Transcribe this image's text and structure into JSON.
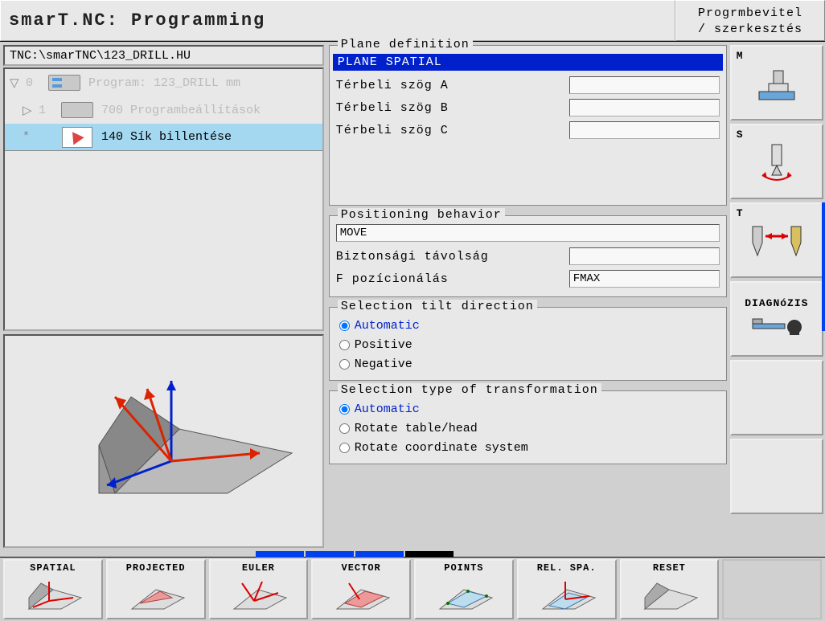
{
  "header": {
    "title": "smarT.NC: Programming",
    "mode_line1": "Progrmbevitel",
    "mode_line2": "/ szerkesztés"
  },
  "filepath": "TNC:\\smarTNC\\123_DRILL.HU",
  "tree": {
    "items": [
      {
        "expand": "▽",
        "num": "0",
        "label": "Program: 123_DRILL mm",
        "icon": "program-icon"
      },
      {
        "expand": "▷",
        "num": "1",
        "label": "700 Programbeállítások",
        "icon": "settings-icon"
      },
      {
        "expand": "*",
        "num": "",
        "label": "140 Sík billentése",
        "icon": "tilt-icon",
        "selected": true
      }
    ]
  },
  "plane": {
    "legend": "Plane definition",
    "highlight": "PLANE SPATIAL",
    "rows": [
      {
        "label": "Térbeli szög A",
        "value": ""
      },
      {
        "label": "Térbeli szög B",
        "value": ""
      },
      {
        "label": "Térbeli szög C",
        "value": ""
      }
    ]
  },
  "positioning": {
    "legend": "Positioning behavior",
    "mode_value": "MOVE",
    "rows": [
      {
        "label": "Biztonsági távolság",
        "value": ""
      },
      {
        "label": "F pozícionálás",
        "value": "FMAX"
      }
    ]
  },
  "tilt": {
    "legend": "Selection tilt direction",
    "options": [
      {
        "label": "Automatic",
        "checked": true,
        "auto": true
      },
      {
        "label": "Positive",
        "checked": false
      },
      {
        "label": "Negative",
        "checked": false
      }
    ]
  },
  "transform": {
    "legend": "Selection type of transformation",
    "options": [
      {
        "label": "Automatic",
        "checked": true,
        "auto": true
      },
      {
        "label": "Rotate table/head",
        "checked": false
      },
      {
        "label": "Rotate coordinate system",
        "checked": false
      }
    ]
  },
  "side": {
    "buttons": [
      {
        "letter": "M",
        "name": "machine-button"
      },
      {
        "letter": "S",
        "name": "spindle-button"
      },
      {
        "letter": "T",
        "name": "tool-button"
      },
      {
        "letter": "",
        "name": "diagnosis-button",
        "label": "DIAGNóZIS"
      },
      {
        "letter": "",
        "name": "empty1"
      },
      {
        "letter": "",
        "name": "empty2"
      }
    ]
  },
  "softkeys": [
    {
      "label": "SPATIAL",
      "name": "softkey-spatial"
    },
    {
      "label": "PROJECTED",
      "name": "softkey-projected"
    },
    {
      "label": "EULER",
      "name": "softkey-euler"
    },
    {
      "label": "VECTOR",
      "name": "softkey-vector"
    },
    {
      "label": "POINTS",
      "name": "softkey-points"
    },
    {
      "label": "REL. SPA.",
      "name": "softkey-relspa"
    },
    {
      "label": "RESET",
      "name": "softkey-reset"
    },
    {
      "label": "",
      "name": "softkey-empty",
      "empty": true
    }
  ]
}
